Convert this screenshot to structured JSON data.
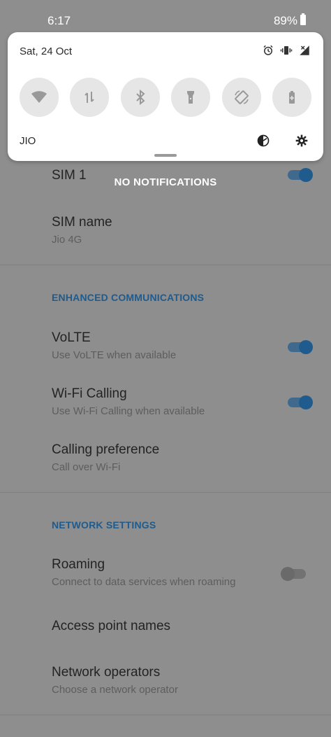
{
  "status_bar": {
    "time": "6:17",
    "battery": "89%"
  },
  "shade": {
    "date": "Sat, 24 Oct",
    "carrier": "JIO",
    "status_icons": [
      "alarm-icon",
      "vibrate-icon",
      "signal-no-data-icon"
    ],
    "tiles": [
      {
        "name": "wifi",
        "icon": "wifi-icon"
      },
      {
        "name": "mobile-data",
        "icon": "data-arrows-icon"
      },
      {
        "name": "bluetooth",
        "icon": "bluetooth-icon"
      },
      {
        "name": "flashlight",
        "icon": "flashlight-icon"
      },
      {
        "name": "auto-rotate",
        "icon": "rotate-icon"
      },
      {
        "name": "battery-saver",
        "icon": "battery-icon"
      }
    ]
  },
  "notifications": {
    "empty_label": "NO NOTIFICATIONS"
  },
  "settings": {
    "sim": {
      "title": "SIM 1",
      "enabled": true
    },
    "sim_name": {
      "title": "SIM name",
      "summary": "Jio 4G"
    },
    "enhanced_header": "ENHANCED COMMUNICATIONS",
    "volte": {
      "title": "VoLTE",
      "summary": "Use VoLTE when available",
      "enabled": true
    },
    "wifi_calling": {
      "title": "Wi-Fi Calling",
      "summary": "Use Wi-Fi Calling when available",
      "enabled": true
    },
    "calling_pref": {
      "title": "Calling preference",
      "summary": "Call over Wi-Fi"
    },
    "network_header": "NETWORK SETTINGS",
    "roaming": {
      "title": "Roaming",
      "summary": "Connect to data services when roaming",
      "enabled": false
    },
    "apn": {
      "title": "Access point names"
    },
    "operators": {
      "title": "Network operators",
      "summary": "Choose a network operator"
    }
  },
  "colors": {
    "accent": "#1f5b8c",
    "scrim": "#8e8e8e",
    "shade": "#ffffff"
  }
}
